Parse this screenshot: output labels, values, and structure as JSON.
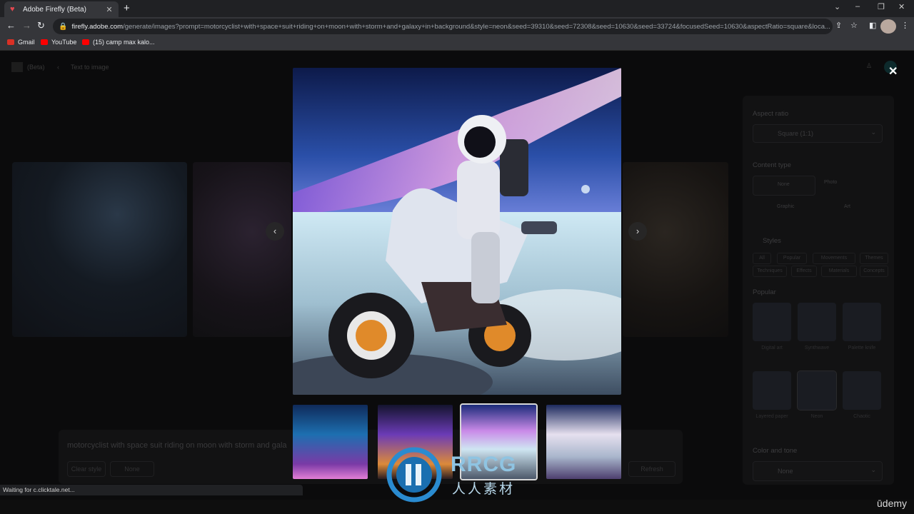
{
  "browser": {
    "tab_title": "Adobe Firefly (Beta)",
    "new_tab": "+",
    "url_host": "firefly.adobe.com",
    "url_rest": "/generate/images?prompt=motorcyclist+with+space+suit+riding+on+moon+with+storm+and+galaxy+in+background&style=neon&seed=39310&seed=72308&seed=10630&seed=33724&focusedSeed=10630&aspectRatio=square&loca...",
    "bookmarks": [
      {
        "label": "Gmail",
        "color": "#d93025"
      },
      {
        "label": "YouTube",
        "color": "#ff0000"
      },
      {
        "label": "(15) camp max kalo...",
        "color": "#ff0000"
      }
    ],
    "status_text": "Waiting for c.clicktale.net..."
  },
  "app": {
    "logo_text": "(Beta)",
    "breadcrumb": "Text to image"
  },
  "panel": {
    "aspect_ratio_heading": "Aspect ratio",
    "aspect_ratio_value": "Square (1:1)",
    "content_type_heading": "Content type",
    "content_types": [
      "None",
      "Photo",
      "Graphic",
      "Art"
    ],
    "styles_heading": "Styles",
    "style_chips_row1": [
      "All",
      "Popular",
      "Movements",
      "Themes"
    ],
    "style_chips_row2": [
      "Techniques",
      "Effects",
      "Materials",
      "Concepts"
    ],
    "popular_heading": "Popular",
    "popular_row1": [
      "Digital art",
      "Synthwave",
      "Palette knife"
    ],
    "popular_row2": [
      "Layered paper",
      "Neon",
      "Chaotic"
    ],
    "color_tone_heading": "Color and tone",
    "color_tone_value": "None"
  },
  "prompt": {
    "text": "motorcyclist with space suit riding on moon with storm and gala",
    "clear_style": "Clear style",
    "none_chip": "None",
    "refresh": "Refresh"
  },
  "watermark": {
    "line1": "RRCG",
    "line2": "人人素材"
  },
  "footer": {
    "brand": "ūdemy"
  }
}
